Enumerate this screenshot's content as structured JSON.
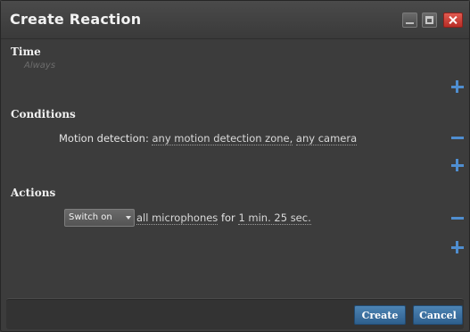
{
  "window": {
    "title": "Create Reaction",
    "minimize_icon": "minimize-icon",
    "maximize_icon": "maximize-icon",
    "close_icon": "close-icon",
    "close_color": "#c9362f"
  },
  "time": {
    "heading": "Time",
    "hint": "Always"
  },
  "conditions": {
    "heading": "Conditions",
    "items": [
      {
        "label": "Motion detection:",
        "zone": "any motion detection zone,",
        "camera": "any camera"
      }
    ]
  },
  "actions": {
    "heading": "Actions",
    "items": [
      {
        "verb": "Switch on",
        "target": "all microphones",
        "for_label": "for",
        "duration": "1 min. 25 sec."
      }
    ]
  },
  "footer": {
    "create_label": "Create",
    "cancel_label": "Cancel"
  },
  "colors": {
    "accent": "#4f8ed0",
    "button": "#3a6fa0"
  }
}
